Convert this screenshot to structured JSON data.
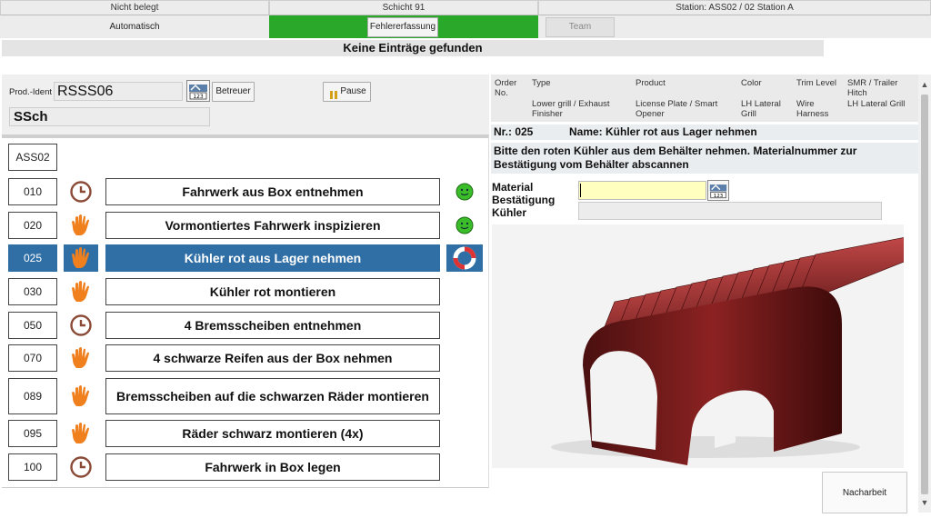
{
  "top_bar": {
    "cell1": "Nicht belegt",
    "cell2": "Schicht 91",
    "cell3": "Station: ASS02 / 02 Station A"
  },
  "nav": {
    "automatic": "Automatisch",
    "error_capture": "Fehlererfassung",
    "team": "Team"
  },
  "banner": "Keine Einträge gefunden",
  "left": {
    "prod_ident_label": "Prod.-Ident",
    "prod_ident_value": "RSSS06",
    "betreuer_button": "Betreuer",
    "pause_button": "Pause",
    "user": "SSch",
    "station": "ASS02"
  },
  "steps": [
    {
      "num": "010",
      "text": "Fahrwerk aus Box entnehmen",
      "icon": "clock-icon",
      "status": "smiley-icon"
    },
    {
      "num": "020",
      "text": "Vormontiertes Fahrwerk inspizieren",
      "icon": "hand-icon",
      "status": "smiley-icon"
    },
    {
      "num": "025",
      "text": "Kühler rot aus Lager nehmen",
      "icon": "hand-icon",
      "status": "lifebuoy-icon",
      "selected": true
    },
    {
      "num": "030",
      "text": "Kühler rot montieren",
      "icon": "hand-icon"
    },
    {
      "num": "050",
      "text": "4 Bremsscheiben entnehmen",
      "icon": "clock-icon"
    },
    {
      "num": "070",
      "text": "4 schwarze Reifen aus der Box nehmen",
      "icon": "hand-icon"
    },
    {
      "num": "089",
      "text": "Bremsscheiben auf die schwarzen Räder montieren",
      "icon": "hand-icon"
    },
    {
      "num": "095",
      "text": "Räder schwarz montieren (4x)",
      "icon": "hand-icon"
    },
    {
      "num": "100",
      "text": "Fahrwerk in Box legen",
      "icon": "clock-icon"
    }
  ],
  "order_header": {
    "order_no": "Order No.",
    "type": "Type",
    "type_val": "Lower grill / Exhaust Finisher",
    "product": "Product",
    "product_val": "License Plate / Smart Opener",
    "color": "Color",
    "color_val": "LH Lateral Grill",
    "trim": "Trim Level",
    "trim_val": "Wire Harness",
    "smr": "SMR / Trailer Hitch",
    "smr_val": "LH Lateral Grill"
  },
  "detail": {
    "nr": "Nr.: 025",
    "name": "Name: Kühler rot aus Lager nehmen",
    "instruction": "Bitte den roten Kühler aus dem Behälter nehmen. Materialnummer zur Bestätigung vom Behälter abscannen",
    "material_label": "Material Bestätigung Kühler",
    "material_value": "",
    "rework_button": "Nacharbeit"
  },
  "colors": {
    "nav_green": "#2aa82a",
    "selected_blue": "#2f6fa6",
    "hand_orange": "#f07f1e",
    "clock_brown": "#8a4a36",
    "smiley_green": "#3bbd2a",
    "input_yellow": "#ffffc0"
  }
}
